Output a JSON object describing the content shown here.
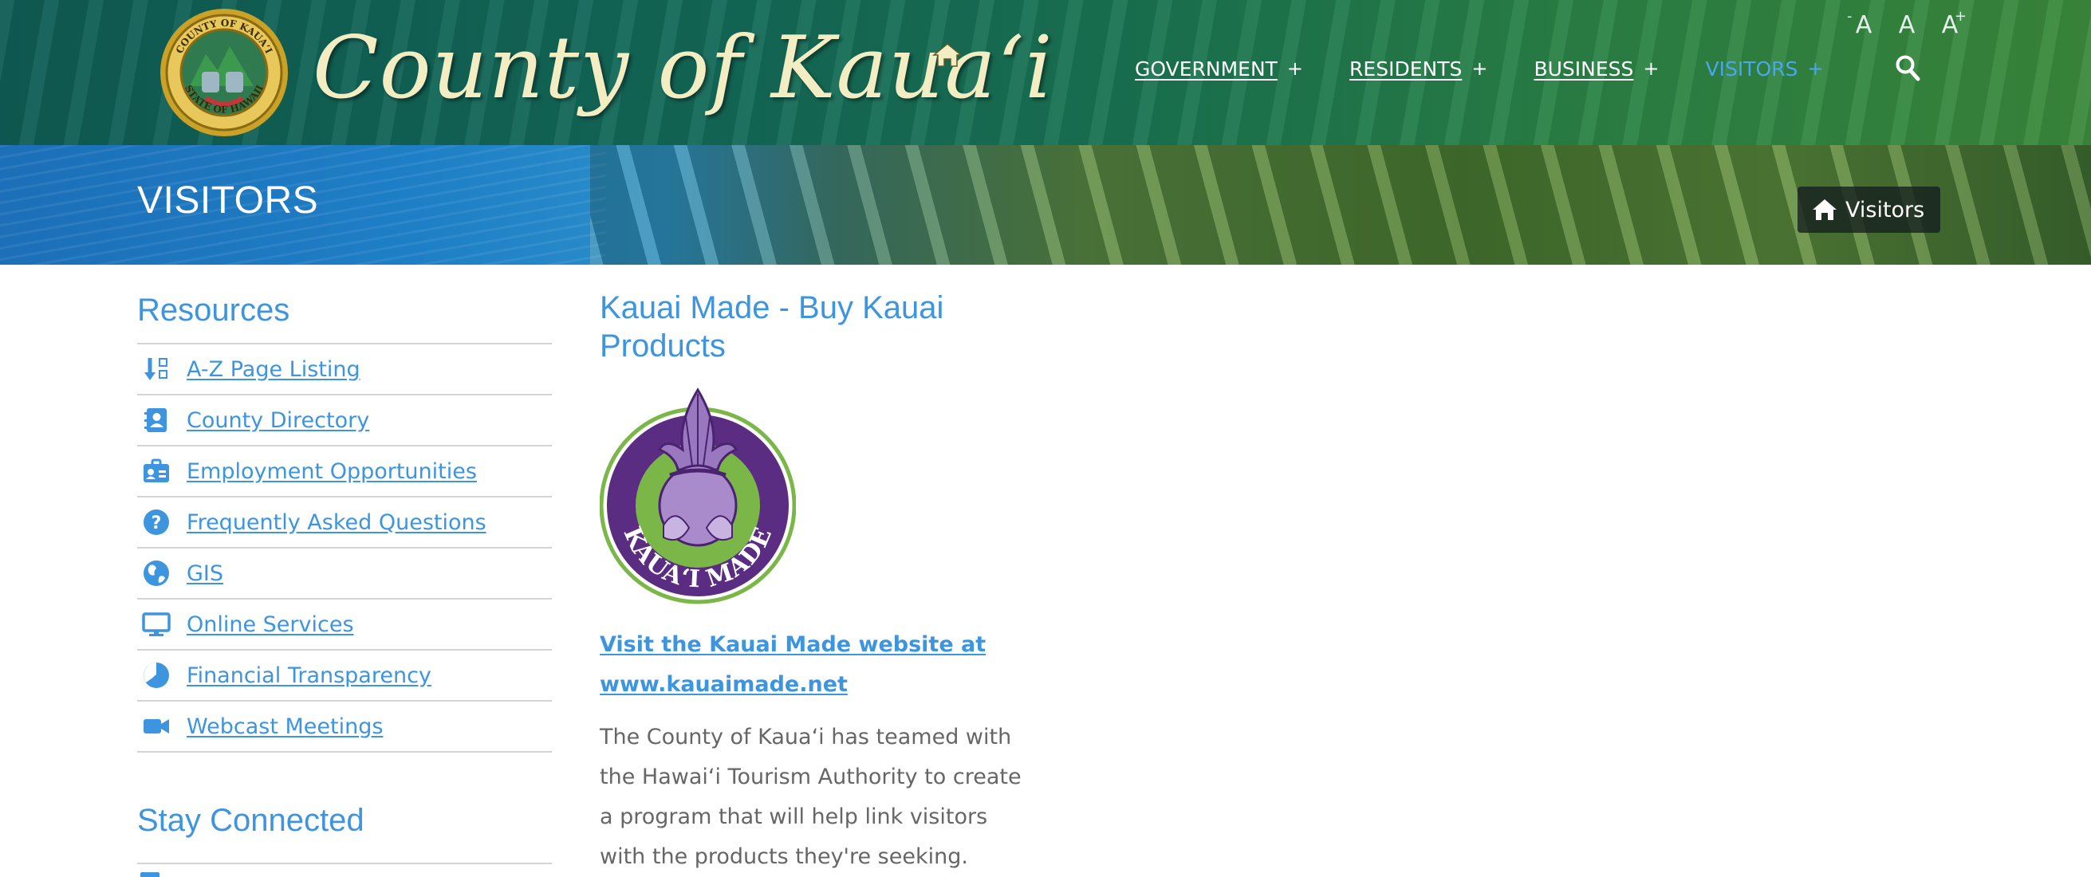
{
  "header": {
    "site_title": "County of Kauaʻi",
    "seal_text_top": "COUNTY OF KAUAʻI",
    "seal_text_bottom": "STATE OF HAWAII",
    "nav": [
      {
        "label": "GOVERNMENT",
        "expand": "+"
      },
      {
        "label": "RESIDENTS",
        "expand": "+"
      },
      {
        "label": "BUSINESS",
        "expand": "+"
      },
      {
        "label": "VISITORS",
        "expand": "+"
      }
    ],
    "font_controls": [
      {
        "label": "A",
        "modifier": "-"
      },
      {
        "label": "A",
        "modifier": ""
      },
      {
        "label": "A",
        "modifier": "+"
      }
    ],
    "search_icon": "search-icon"
  },
  "banner": {
    "heading": "VISITORS",
    "breadcrumb": {
      "icon": "home-icon",
      "label": "Visitors"
    }
  },
  "sidebar": {
    "resources_title": "Resources",
    "resources": [
      {
        "icon": "sort-alpha-icon",
        "label": "A-Z Page Listing"
      },
      {
        "icon": "contact-book-icon",
        "label": "County Directory"
      },
      {
        "icon": "id-badge-icon",
        "label": "Employment Opportunities"
      },
      {
        "icon": "question-circle-icon",
        "label": "Frequently Asked Questions"
      },
      {
        "icon": "globe-icon",
        "label": "GIS"
      },
      {
        "icon": "monitor-icon",
        "label": "Online Services"
      },
      {
        "icon": "pie-chart-icon",
        "label": "Financial Transparency"
      },
      {
        "icon": "video-camera-icon",
        "label": "Webcast Meetings"
      }
    ],
    "stay_connected_title": "Stay Connected"
  },
  "main": {
    "title": "Kauai Made - Buy Kauai Products",
    "logo_text": "KAUAʻI MADE",
    "link_text": "Visit the Kauai Made website at www.kauaimade.net",
    "body": "The County of Kauaʻi has teamed with the Hawaiʻi Tourism Authority to create a program that will help link visitors with the products they're seeking."
  },
  "colors": {
    "accent": "#3d95e0",
    "active_nav": "#4aa6ee",
    "header_green": "#136a58",
    "title_cream": "#f3edc4",
    "logo_purple": "#5b2d82",
    "logo_green": "#7ab648"
  }
}
